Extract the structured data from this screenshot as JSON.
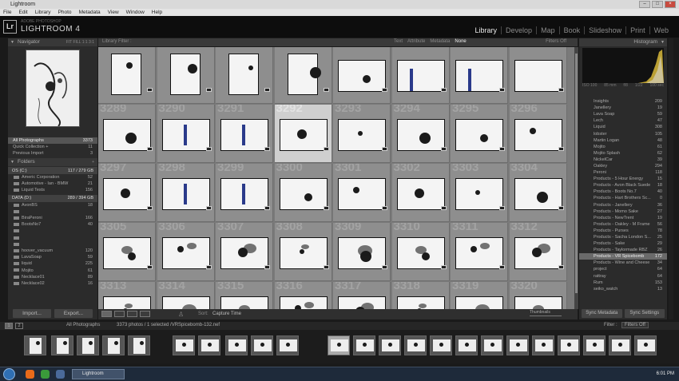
{
  "window": {
    "title": "Lightroom"
  },
  "menu": [
    "File",
    "Edit",
    "Library",
    "Photo",
    "Metadata",
    "View",
    "Window",
    "Help"
  ],
  "brand": {
    "sub": "ADOBE PHOTOSHOP",
    "name": "LIGHTROOM 4",
    "logo": "Lr"
  },
  "modules": [
    {
      "label": "Library",
      "active": true
    },
    {
      "label": "Develop"
    },
    {
      "label": "Map"
    },
    {
      "label": "Book"
    },
    {
      "label": "Slideshow"
    },
    {
      "label": "Print"
    },
    {
      "label": "Web"
    }
  ],
  "navigator": {
    "title": "Navigator",
    "opts": "FIT  FILL  1:1  3:1"
  },
  "catalog": [
    {
      "label": "All Photographs",
      "count": "3373",
      "selected": true
    },
    {
      "label": "Quick Collection +",
      "count": "11"
    },
    {
      "label": "Previous Import",
      "count": "3"
    }
  ],
  "folders_title": "Folders",
  "drive1": {
    "label": "OS (C:)",
    "info": "117 / 279 GB"
  },
  "folders1": [
    {
      "label": "Americ Corporation",
      "count": "52"
    },
    {
      "label": "Automotive - Ian - BMW",
      "count": "21"
    },
    {
      "label": "Liquid Tests",
      "count": "156"
    }
  ],
  "drive2": {
    "label": "DATA (D:)",
    "info": "289 / 394 GB"
  },
  "folders2": [
    {
      "label": "AvonBS",
      "count": "18"
    },
    {
      "label": "",
      "count": ""
    },
    {
      "label": "BiraPeroni",
      "count": "166"
    },
    {
      "label": "BootsNo7",
      "count": "40"
    },
    {
      "label": "",
      "count": "",
      "dim": true
    },
    {
      "label": "",
      "count": "",
      "dim": true
    },
    {
      "label": "",
      "count": "",
      "dim": true
    },
    {
      "label": "hoover_vacuum",
      "count": "120"
    },
    {
      "label": "LavaSoap",
      "count": "59"
    },
    {
      "label": "liquid",
      "count": "225"
    },
    {
      "label": "Mojito",
      "count": "61"
    },
    {
      "label": "Necklace01",
      "count": "89"
    },
    {
      "label": "Necklace02",
      "count": "16"
    }
  ],
  "left_buttons": {
    "import": "Import...",
    "export": "Export..."
  },
  "filterbar": {
    "label": "Library Filter :",
    "tabs": [
      "Text",
      "Attribute",
      "Metadata",
      "None"
    ],
    "active": "None",
    "filters": "Filters Off"
  },
  "grid_numbers": [
    [
      "",
      "",
      "",
      "",
      "",
      "",
      "",
      ""
    ],
    [
      "3289",
      "3290",
      "3291",
      "3292",
      "3293",
      "3294",
      "3295",
      "3296"
    ],
    [
      "3297",
      "3298",
      "3299",
      "3300",
      "3301",
      "3302",
      "3303",
      "3304"
    ],
    [
      "3305",
      "3306",
      "3307",
      "3308",
      "3309",
      "3310",
      "3311",
      "3312"
    ],
    [
      "3313",
      "3314",
      "3315",
      "3316",
      "3317",
      "3318",
      "3319",
      "3320"
    ]
  ],
  "selected_cell": [
    1,
    3
  ],
  "toolbar": {
    "sort_label": "Sort:",
    "sort_value": "Capture Time",
    "thumbs_label": "Thumbnails"
  },
  "histogram": {
    "title": "Histogram",
    "info": [
      "ISO 100",
      "85 mm",
      "f/8",
      "1/22",
      "100 sec"
    ]
  },
  "keywords": [
    {
      "label": "Insights",
      "count": "209"
    },
    {
      "label": "Janellery",
      "count": "19"
    },
    {
      "label": "Lava Soap",
      "count": "59"
    },
    {
      "label": "Lech",
      "count": "47"
    },
    {
      "label": "Liquid",
      "count": "308"
    },
    {
      "label": "lobster",
      "count": "105"
    },
    {
      "label": "Martin Logan",
      "count": "48"
    },
    {
      "label": "Mojito",
      "count": "61"
    },
    {
      "label": "Mojito Splash",
      "count": "62"
    },
    {
      "label": "NickelCar",
      "count": "39"
    },
    {
      "label": "Oakley",
      "count": "294"
    },
    {
      "label": "Peroni",
      "count": "118"
    },
    {
      "label": "Products - 5 Hour Energy",
      "count": "15"
    },
    {
      "label": "Products - Avon Black Suede",
      "count": "18"
    },
    {
      "label": "Products - Boots No.7",
      "count": "40"
    },
    {
      "label": "Products - Hart Brothers Sc...",
      "count": "0"
    },
    {
      "label": "Products - Janellery",
      "count": "36"
    },
    {
      "label": "Products - Momo Sake",
      "count": "27"
    },
    {
      "label": "Products - NewTrent",
      "count": "19"
    },
    {
      "label": "Products - Oakley - M Frame",
      "count": "56"
    },
    {
      "label": "Products - Purses",
      "count": "78"
    },
    {
      "label": "Products - Sacha London S...",
      "count": "25"
    },
    {
      "label": "Products - Sake",
      "count": "29"
    },
    {
      "label": "Products - Taylormade RBZ",
      "count": "26"
    },
    {
      "label": "Products - VR Spicebomb",
      "count": "172",
      "selected": true
    },
    {
      "label": "Products - Wine and Cheese",
      "count": "34"
    },
    {
      "label": "project",
      "count": "64"
    },
    {
      "label": "rattray",
      "count": "64"
    },
    {
      "label": "Rum",
      "count": "153"
    },
    {
      "label": "seiko_watch",
      "count": "13"
    }
  ],
  "right_buttons": {
    "sync_meta": "Sync Metadata",
    "sync_settings": "Sync Settings"
  },
  "filmstrip_bar": {
    "page1": "1",
    "page2": "2",
    "source": "All Photographs",
    "info": "3373 photos / 1 selected /VRSpicebomb-132.nef",
    "filter_label": "Filter :",
    "filter_value": "Filters Off"
  },
  "taskbar": {
    "app": "Lightroom",
    "time": "6:01 PM"
  }
}
